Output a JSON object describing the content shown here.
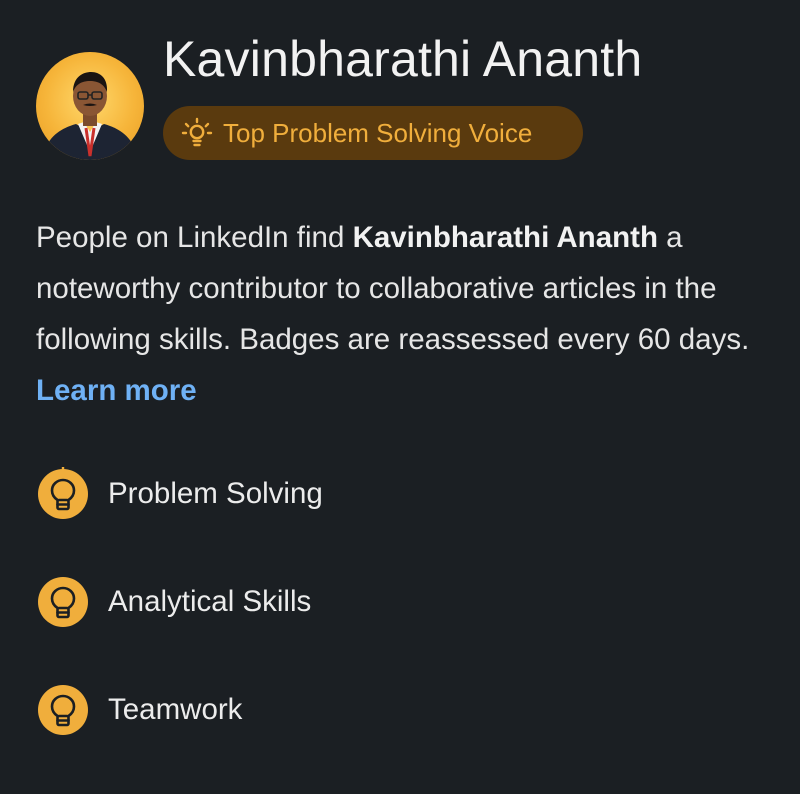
{
  "profile": {
    "name": "Kavinbharathi Ananth",
    "avatar_icon": "profile-photo"
  },
  "badge": {
    "label": "Top Problem Solving Voice",
    "icon": "lightbulb-spark-icon",
    "bg_color": "#5a3a0e",
    "text_color": "#f0ae3c"
  },
  "description": {
    "prefix": "People on LinkedIn find ",
    "name_bold": "Kavinbharathi Ananth",
    "suffix": " a noteworthy contributor to collaborative articles in the following skills. Badges are reassessed every 60 days. ",
    "learn_more": "Learn more",
    "link_color": "#6fb1f5"
  },
  "skills": [
    {
      "label": "Problem Solving",
      "icon": "lightbulb-icon"
    },
    {
      "label": "Analytical Skills",
      "icon": "lightbulb-icon"
    },
    {
      "label": "Teamwork",
      "icon": "lightbulb-icon"
    }
  ],
  "colors": {
    "background": "#1b1f23",
    "accent": "#f0ae3c"
  }
}
